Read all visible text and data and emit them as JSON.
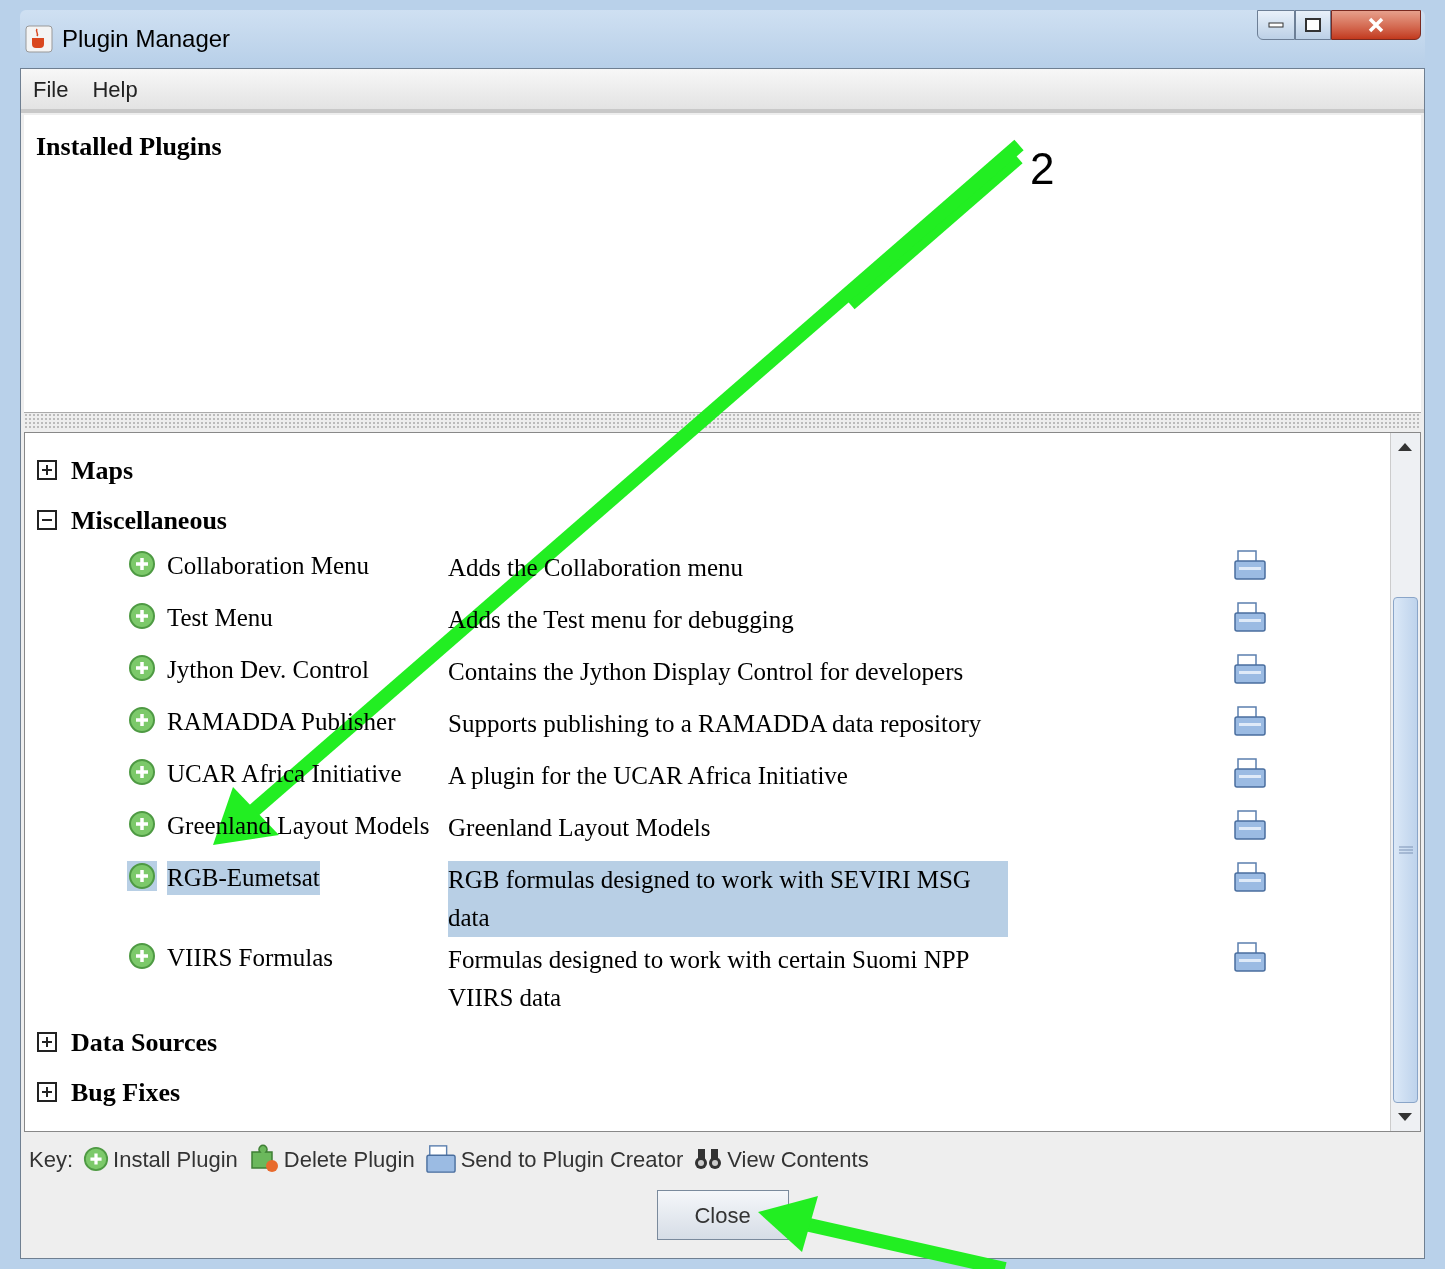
{
  "window": {
    "title": "Plugin Manager"
  },
  "menu": [
    "File",
    "Help"
  ],
  "installed": {
    "title": "Installed Plugins"
  },
  "tree": [
    {
      "label": "Maps",
      "expanded": false
    },
    {
      "label": "Miscellaneous",
      "expanded": true,
      "children": [
        {
          "name": "Collaboration Menu",
          "description": "Adds the Collaboration menu",
          "selected": false
        },
        {
          "name": "Test Menu",
          "description": "Adds the Test menu for debugging",
          "selected": false
        },
        {
          "name": "Jython Dev. Control",
          "description": "Contains the Jython Display Control for developers",
          "selected": false
        },
        {
          "name": "RAMADDA Publisher",
          "description": "Supports publishing to a RAMADDA data repository",
          "selected": false
        },
        {
          "name": "UCAR Africa Initiative",
          "description": "A plugin for the UCAR Africa Initiative",
          "selected": false
        },
        {
          "name": "Greenland Layout Models",
          "description": "Greenland Layout Models",
          "selected": false
        },
        {
          "name": "RGB-Eumetsat",
          "description": "RGB formulas designed to work with SEVIRI MSG data",
          "selected": true
        },
        {
          "name": "VIIRS Formulas",
          "description": "Formulas designed to work with certain Suomi NPP VIIRS data",
          "selected": false
        }
      ]
    },
    {
      "label": "Data Sources",
      "expanded": false
    },
    {
      "label": "Bug Fixes",
      "expanded": false
    }
  ],
  "key": {
    "label": "Key:",
    "items": [
      {
        "kind": "install",
        "label": "Install Plugin"
      },
      {
        "kind": "delete",
        "label": "Delete Plugin"
      },
      {
        "kind": "send",
        "label": "Send to Plugin Creator"
      },
      {
        "kind": "view",
        "label": "View Contents"
      }
    ]
  },
  "buttons": [
    {
      "label": "Close"
    }
  ],
  "annotations": [
    {
      "kind": "arrow",
      "label": "2"
    },
    {
      "kind": "arrow"
    }
  ]
}
